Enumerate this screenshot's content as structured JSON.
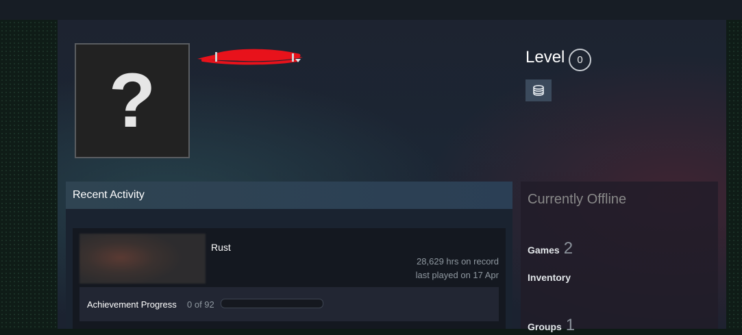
{
  "profile": {
    "avatar_placeholder": "?",
    "level_label": "Level",
    "level_value": "0"
  },
  "recent_activity": {
    "title": "Recent Activity",
    "game": {
      "name": "Rust",
      "hours": "28,629 hrs on record",
      "last_played": "last played on 17 Apr",
      "achievement_label": "Achievement Progress",
      "achievement_count": "0 of 92",
      "achievement_progress": 0
    }
  },
  "sidebar": {
    "status": "Currently Offline",
    "games_label": "Games",
    "games_count": "2",
    "inventory_label": "Inventory",
    "groups_label": "Groups",
    "groups_count": "1"
  },
  "colors": {
    "accent": "#66c0f4",
    "redaction": "#e8121b"
  }
}
